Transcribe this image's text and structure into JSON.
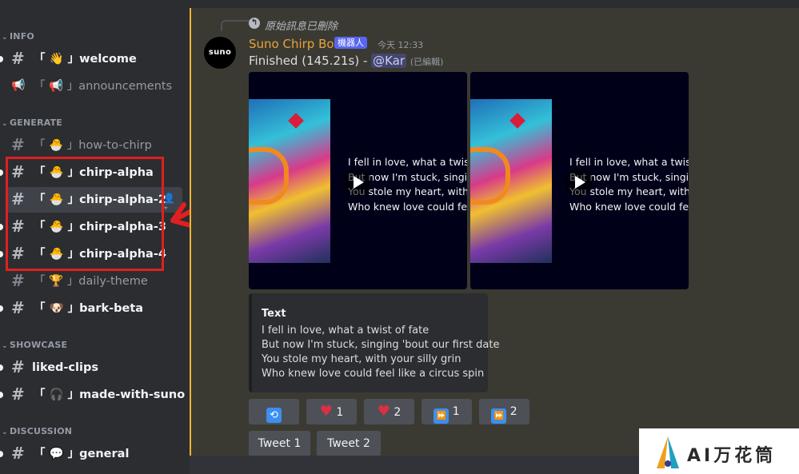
{
  "sidebar": {
    "categories": {
      "info": "INFO",
      "generate": "GENERATE",
      "showcase": "SHOWCASE",
      "discussion": "DISCUSSION"
    },
    "channels": {
      "welcome": "「 👋 」welcome",
      "announcements": "「 📢 」announcements",
      "how_to_chirp": "「 🐣 」how-to-chirp",
      "chirp_alpha": "「 🐣 」chirp-alpha",
      "chirp_alpha_2": "「 🐣 」chirp-alpha-2",
      "chirp_alpha_3": "「 🐣 」chirp-alpha-3",
      "chirp_alpha_4": "「 🐣 」chirp-alpha-4",
      "daily_theme": "「 🏆 」daily-theme",
      "bark_beta": "「 🐶 」bark-beta",
      "liked_clips": "liked-clips",
      "made_with_suno": "「 🎧 」made-with-suno",
      "general": "「 💬 」general"
    }
  },
  "message": {
    "reply_text": "原始訊息已刪除",
    "avatar_text": "suno",
    "author": "Suno Chirp Bot",
    "bot_tag": "機器人",
    "timestamp": "今天 12:33",
    "body_prefix": "Finished (145.21s) - ",
    "mention": "@Kar",
    "edited": "(已編輯)"
  },
  "videos": [
    {
      "lyrics": [
        "I fell in love, what a twist o",
        "But now I'm stuck, singing",
        "You stole my heart, with y",
        "Who knew love could feel"
      ]
    },
    {
      "lyrics": [
        "I fell in love, what a twist o",
        "But now I'm stuck, singing",
        "You stole my heart, with y",
        "Who knew love could feel"
      ]
    }
  ],
  "embed": {
    "title": "Text",
    "lines": [
      "I fell in love, what a twist of fate",
      "But now I'm stuck, singing 'bout our first date",
      "You stole my heart, with your silly grin",
      "Who knew love could feel like a circus spin"
    ]
  },
  "buttons": {
    "like_count": "1",
    "like2_count": "2",
    "ff1_count": "1",
    "ff2_count": "2",
    "tweet1": "Tweet 1",
    "tweet2": "Tweet 2"
  },
  "watermark": {
    "text": "AI万花筒"
  },
  "colors": {
    "accent_bot": "#5865f2",
    "author": "#e8a23b",
    "highlight_border": "#f0b232",
    "annotation_red": "#e02020"
  }
}
